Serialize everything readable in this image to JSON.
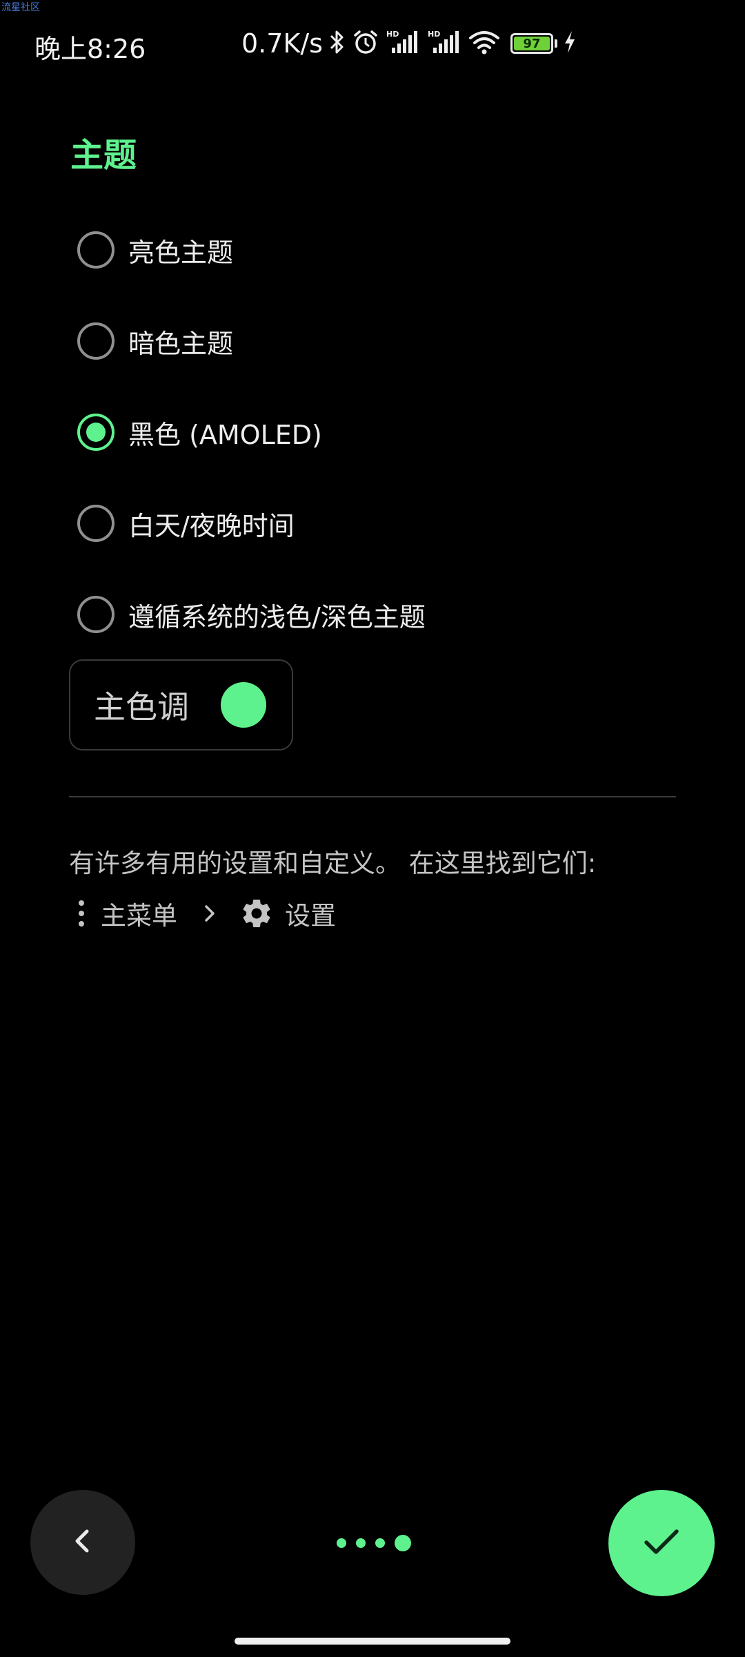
{
  "watermark": "流星社区",
  "status_bar": {
    "time": "晚上8:26",
    "net_speed": "0.7K/s",
    "battery_level": "97",
    "icons": [
      "bluetooth-icon",
      "alarm-icon",
      "hd-signal-icon",
      "hd-signal-icon",
      "wifi-icon",
      "battery-icon",
      "charging-icon"
    ]
  },
  "theme_section": {
    "title": "主题",
    "options": [
      {
        "label": "亮色主题",
        "selected": false
      },
      {
        "label": "暗色主题",
        "selected": false
      },
      {
        "label": "黑色 (AMOLED)",
        "selected": true
      },
      {
        "label": "白天/夜晚时间",
        "selected": false
      },
      {
        "label": "遵循系统的浅色/深色主题",
        "selected": false
      }
    ]
  },
  "accent": {
    "label": "主色调",
    "color": "#5ef28e"
  },
  "hint": {
    "text": "有许多有用的设置和自定义。 在这里找到它们:",
    "menu_label": "主菜单",
    "settings_label": "设置"
  },
  "navigation": {
    "back_icon": "chevron-left-icon",
    "done_icon": "check-icon",
    "pages_total": 4,
    "current_page": 4
  },
  "colors": {
    "accent": "#5ef28e",
    "background": "#000000"
  }
}
